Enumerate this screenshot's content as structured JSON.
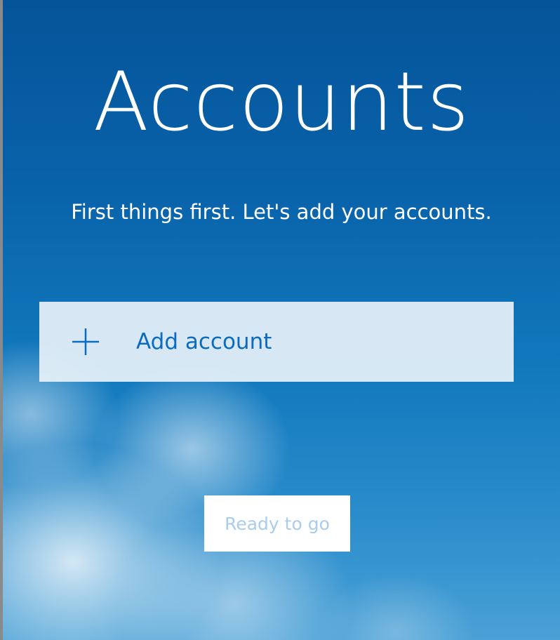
{
  "header": {
    "title": "Accounts",
    "subtitle": "First things first. Let's add your accounts."
  },
  "actions": {
    "add_account": {
      "label": "Add account",
      "icon": "plus-icon"
    },
    "ready": {
      "label": "Ready to go",
      "state": "disabled"
    }
  },
  "colors": {
    "background_top": "#05549a",
    "background_bottom": "#4aa1d6",
    "add_account_bg": "#e6f1f9",
    "add_account_text": "#0a6bc1",
    "ready_text_disabled": "#a9cdeb",
    "ready_bg": "#ffffff"
  }
}
